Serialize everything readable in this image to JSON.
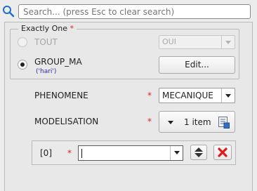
{
  "search": {
    "placeholder": "Search... (press Esc to clear search)"
  },
  "group": {
    "title": "Exactly One",
    "required_marker": "*",
    "options": [
      {
        "label": "TOUT",
        "selected": false,
        "enabled": false,
        "value": "OUI"
      },
      {
        "label": "GROUP_MA",
        "sub_label": "('hari')",
        "selected": true,
        "enabled": true,
        "button": "Edit..."
      }
    ]
  },
  "fields": {
    "phenomene": {
      "label": "PHENOMENE",
      "required_marker": "*",
      "value": "MECANIQUE"
    },
    "modelisation": {
      "label": "MODELISATION",
      "required_marker": "*",
      "count": "1 item"
    }
  },
  "list_item": {
    "index": "[0]",
    "required_marker": "*",
    "value": ""
  },
  "colors": {
    "search_icon": "#1f6fc5",
    "required": "#dd2222",
    "delete": "#e11b1b"
  }
}
